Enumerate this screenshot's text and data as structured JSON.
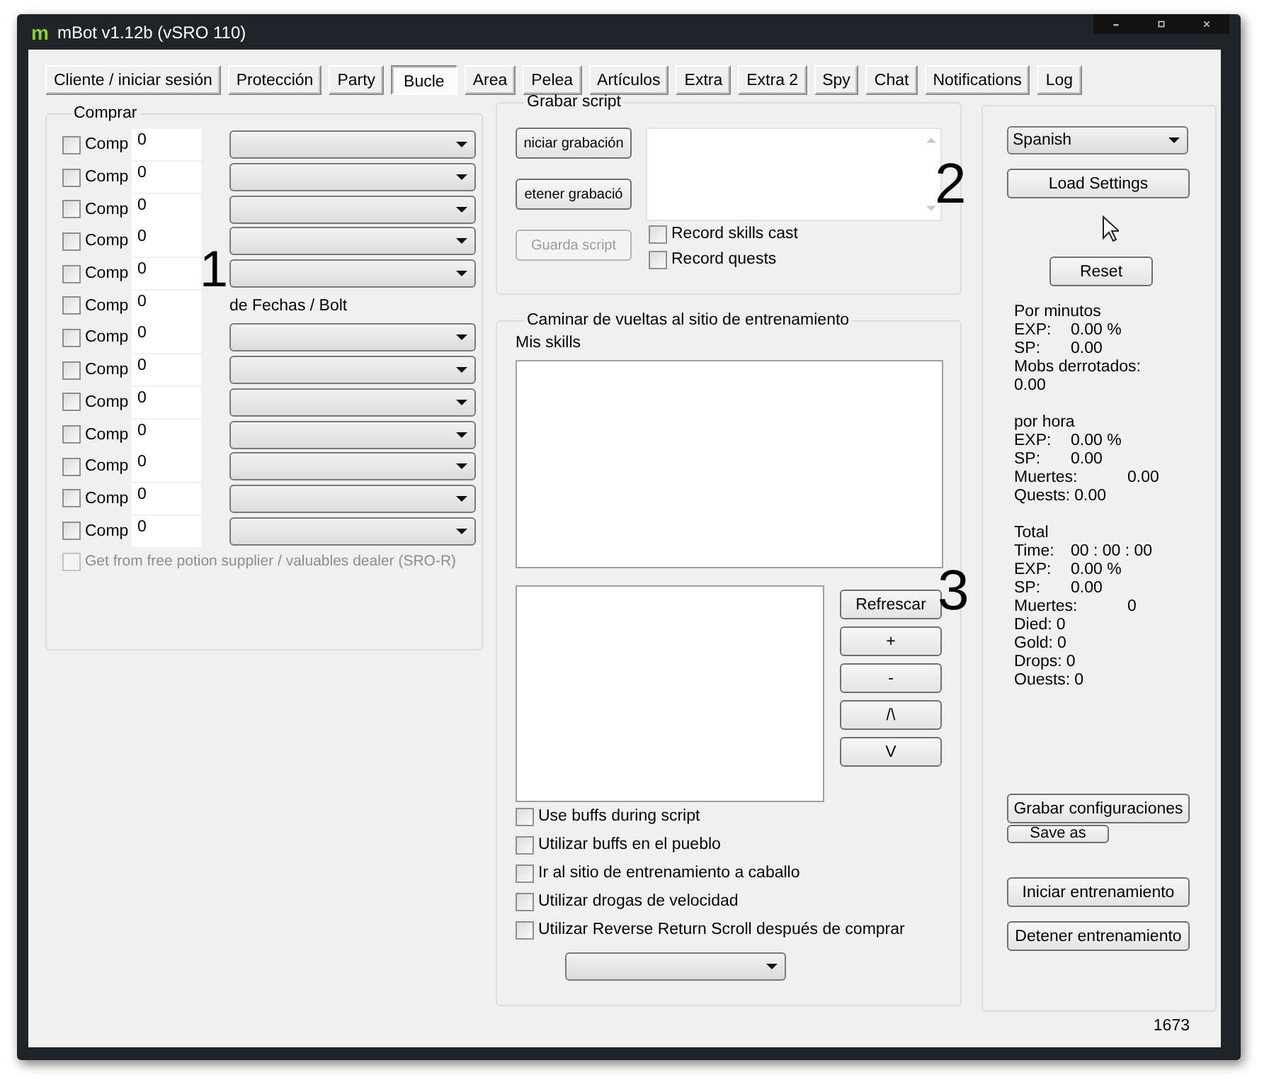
{
  "window": {
    "logo": "m",
    "title": "mBot v1.12b (vSRO 110)"
  },
  "tabs": [
    {
      "label": "Cliente / iniciar sesión",
      "selected": false
    },
    {
      "label": "Protección",
      "selected": false
    },
    {
      "label": "Party",
      "selected": false
    },
    {
      "label": "Bucle",
      "selected": true
    },
    {
      "label": "Area",
      "selected": false
    },
    {
      "label": "Pelea",
      "selected": false
    },
    {
      "label": "Artículos",
      "selected": false
    },
    {
      "label": "Extra",
      "selected": false
    },
    {
      "label": "Extra 2",
      "selected": false
    },
    {
      "label": "Spy",
      "selected": false
    },
    {
      "label": "Chat",
      "selected": false
    },
    {
      "label": "Notifications",
      "selected": false
    },
    {
      "label": "Log",
      "selected": false
    }
  ],
  "comprar": {
    "title": "Comprar",
    "rows": [
      {
        "kind": "combo",
        "checked": false,
        "label": "Comp",
        "quantity": "0"
      },
      {
        "kind": "combo",
        "checked": false,
        "label": "Comp",
        "quantity": "0"
      },
      {
        "kind": "combo",
        "checked": false,
        "label": "Comp",
        "quantity": "0"
      },
      {
        "kind": "combo",
        "checked": false,
        "label": "Comp",
        "quantity": "0"
      },
      {
        "kind": "combo",
        "checked": false,
        "label": "Comp",
        "quantity": "0"
      },
      {
        "kind": "text",
        "checked": false,
        "label": "Comp",
        "quantity": "0",
        "text": "de Fechas / Bolt"
      },
      {
        "kind": "combo",
        "checked": false,
        "label": "Comp",
        "quantity": "0"
      },
      {
        "kind": "combo",
        "checked": false,
        "label": "Comp",
        "quantity": "0"
      },
      {
        "kind": "combo",
        "checked": false,
        "label": "Comp",
        "quantity": "0"
      },
      {
        "kind": "combo",
        "checked": false,
        "label": "Comp",
        "quantity": "0"
      },
      {
        "kind": "combo",
        "checked": false,
        "label": "Comp",
        "quantity": "0"
      },
      {
        "kind": "combo",
        "checked": false,
        "label": "Comp",
        "quantity": "0"
      },
      {
        "kind": "combo",
        "checked": false,
        "label": "Comp",
        "quantity": "0"
      }
    ],
    "supplier": {
      "label": "Get from free potion supplier / valuables dealer (SRO-R)",
      "checked": false,
      "disabled": true
    }
  },
  "record": {
    "title": "Grabar script",
    "buttons": [
      {
        "label": "niciar grabación",
        "disabled": false
      },
      {
        "label": "etener grabació",
        "disabled": false
      },
      {
        "label": "Guarda script",
        "disabled": true
      }
    ],
    "options": [
      {
        "label": "Record skills cast",
        "checked": false
      },
      {
        "label": "Record quests",
        "checked": false
      }
    ]
  },
  "walk": {
    "title": "Caminar de vueltas al sitio de entrenamiento",
    "skills_label": "Mis skills",
    "buttons": [
      "Refrescar",
      "+",
      "-",
      "/\\",
      "V"
    ],
    "options": [
      {
        "label": "Use buffs during script",
        "checked": false
      },
      {
        "label": "Utilizar buffs en el pueblo",
        "checked": false
      },
      {
        "label": "Ir al sitio de entrenamiento a caballo",
        "checked": false
      },
      {
        "label": "Utilizar drogas de velocidad",
        "checked": false
      },
      {
        "label": "Utilizar Reverse Return Scroll después de comprar",
        "checked": false
      }
    ]
  },
  "side": {
    "language": "Spanish",
    "load": "Load Settings",
    "reset": "Reset",
    "stats": [
      {
        "heading": "Por minutos",
        "rows": [
          {
            "kind": "normal",
            "label": "EXP:",
            "value": "0.00 %"
          },
          {
            "kind": "normal",
            "label": "SP:",
            "value": "0.00"
          },
          {
            "kind": "break",
            "label": "Mobs derrotados:",
            "value": "0.00"
          }
        ]
      },
      {
        "heading": "por hora",
        "rows": [
          {
            "kind": "normal",
            "label": "EXP:",
            "value": "0.00 %"
          },
          {
            "kind": "normal",
            "label": "SP:",
            "value": "0.00"
          },
          {
            "kind": "wide",
            "label": "Muertes:",
            "value": "0.00"
          },
          {
            "kind": "tight",
            "label": "Quests:",
            "value": "0.00"
          }
        ]
      },
      {
        "heading": "Total",
        "rows": [
          {
            "kind": "normal",
            "label": "Time:",
            "value": "00 : 00 : 00"
          },
          {
            "kind": "normal",
            "label": "EXP:",
            "value": "0.00 %"
          },
          {
            "kind": "normal",
            "label": "SP:",
            "value": "0.00"
          },
          {
            "kind": "wide",
            "label": "Muertes:",
            "value": "0"
          },
          {
            "kind": "tight",
            "label": "Died:",
            "value": "0"
          },
          {
            "kind": "tight",
            "label": "Gold:",
            "value": "0"
          },
          {
            "kind": "tight",
            "label": "Drops:",
            "value": "0"
          },
          {
            "kind": "tight",
            "label": "Ouests:",
            "value": "0"
          }
        ]
      }
    ],
    "save": "Grabar configuraciones",
    "save_as": "Save as",
    "start": "Iniciar entrenamiento",
    "stop": "Detener entrenamiento"
  },
  "annotations": [
    "1",
    "2",
    "3"
  ],
  "status": "1673"
}
